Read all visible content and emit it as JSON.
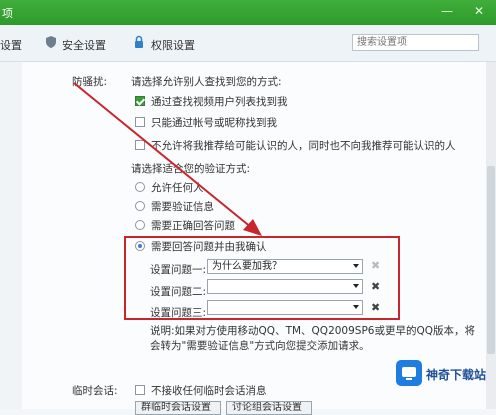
{
  "window": {
    "title_fragment": "项",
    "controls": [
      "—",
      "✕"
    ]
  },
  "toolbar": {
    "tab_partial": "设置",
    "tab_security": "安全设置",
    "tab_permission": "权限设置",
    "search_placeholder": "搜索设置项"
  },
  "section_prevent_harass": {
    "label": "防骚扰:",
    "find_me_heading": "请选择允许别人查找到您的方式:",
    "options": [
      {
        "label": "通过查找视频用户列表找到我",
        "checked": true
      },
      {
        "label": "只能通过帐号或昵称找到我",
        "checked": false
      },
      {
        "label": "不允许将我推荐给可能认识的人，同时也不向我推荐可能认识的人",
        "checked": false
      }
    ],
    "verify_heading": "请选择适合您的验证方式:",
    "verify_options": [
      {
        "label": "允许任何人",
        "selected": false
      },
      {
        "label": "需要验证信息",
        "selected": false
      },
      {
        "label": "需要正确回答问题",
        "selected": false
      },
      {
        "label": "需要回答问题并由我确认",
        "selected": true
      }
    ],
    "questions": [
      {
        "label": "设置问题一:",
        "value": "为什么要加我？"
      },
      {
        "label": "设置问题二:",
        "value": ""
      },
      {
        "label": "设置问题三:",
        "value": ""
      }
    ],
    "note_line1": "说明:如果对方使用移动QQ、TM、QQ2009SP6或更早的QQ版本，将",
    "note_line2": "会转为\"需要验证信息\"方式向您提交添加请求。"
  },
  "section_temp_chat": {
    "label": "临时会话:",
    "option": {
      "label": "不接收任何临时会话消息",
      "checked": false
    },
    "buttons": [
      "群临时会话设置",
      "讨论组会话设置"
    ]
  },
  "watermark": {
    "text": "神奇下载站"
  },
  "colors": {
    "titlebar": "#3fae3a",
    "highlight": "#c8262e",
    "accent_blue": "#3a7bd5"
  }
}
